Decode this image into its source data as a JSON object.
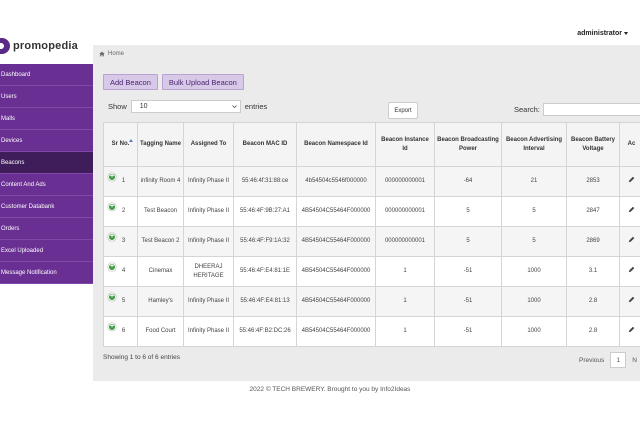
{
  "header": {
    "user": "administrator"
  },
  "brand": {
    "name": "promopedia"
  },
  "sidebar": {
    "items": [
      {
        "label": "Dashboard"
      },
      {
        "label": "Users"
      },
      {
        "label": "Malls"
      },
      {
        "label": "Devices"
      },
      {
        "label": "Beacons",
        "active": true
      },
      {
        "label": "Content And Ads"
      },
      {
        "label": "Customer Databank"
      },
      {
        "label": "Orders"
      },
      {
        "label": "Excel Uploaded"
      },
      {
        "label": "Message Notification"
      }
    ]
  },
  "breadcrumb": {
    "home": "Home"
  },
  "actions": {
    "add": "Add Beacon",
    "bulk": "Bulk Upload Beacon",
    "export": "Export"
  },
  "filter": {
    "show_label": "Show",
    "show_value": "10",
    "entries_label": "entries",
    "search_label": "Search:"
  },
  "table": {
    "headers": [
      "Sr No.",
      "Tagging Name",
      "Assigned To",
      "Beacon MAC ID",
      "Beacon Namespace Id",
      "Beacon Instance Id",
      "Beacon Broadcasting Power",
      "Beacon Advertising Interval",
      "Beacon Battery Voltage",
      "Ac"
    ],
    "rows": [
      [
        "1",
        "infinity Room 4",
        "Infinity Phase II",
        "55:46:4f:31:88:ce",
        "4b54504c5546f000000",
        "000000000001",
        "-64",
        "21",
        "2853"
      ],
      [
        "2",
        "Test Beacon",
        "Infinity Phase II",
        "55:46:4F:9B:27:A1",
        "4B54504C55464F000000",
        "000000000001",
        "5",
        "5",
        "2847"
      ],
      [
        "3",
        "Test Beacon 2",
        "Infinity Phase II",
        "55:46:4F:F9:1A:32",
        "4B54504C55464F000000",
        "000000000001",
        "5",
        "5",
        "2869"
      ],
      [
        "4",
        "Cinemax",
        "DHEERAJ HERITAGE",
        "55:46:4F:E4:81:1E",
        "4B54504C55464F000000",
        "1",
        "-51",
        "1000",
        "3.1"
      ],
      [
        "5",
        "Hamley's",
        "Infinity Phase II",
        "55:46:4F:E4:81:13",
        "4B54504C55464F000000",
        "1",
        "-51",
        "1000",
        "2.8"
      ],
      [
        "6",
        "Food Court",
        "Infinity Phase II",
        "55:46:4F:B2:DC:26",
        "4B54504C55464F000000",
        "1",
        "-51",
        "1000",
        "2.8"
      ]
    ]
  },
  "info": "Showing 1 to 6 of 6 entries",
  "pager": {
    "previous": "Previous",
    "page": "1",
    "next": "N"
  },
  "footer": "2022 © TECH BREWERY. Brought to you by Info2Ideas",
  "colors": {
    "sidebar": "#6a2f92",
    "sidebar_active": "#3e1d5a",
    "button": "#d9c9e8",
    "content_bg": "#ebebeb"
  }
}
